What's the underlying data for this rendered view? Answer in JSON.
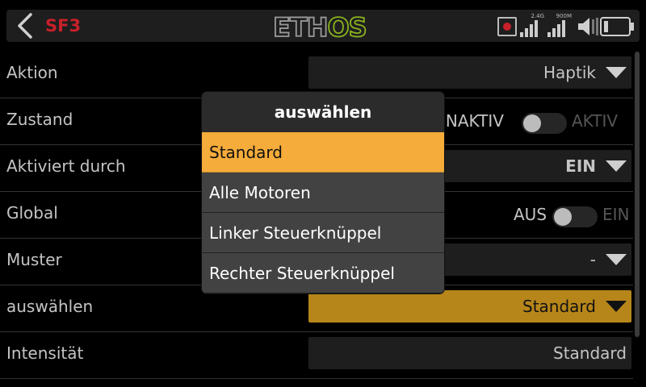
{
  "header": {
    "function_id": "SF3",
    "logo_text": "ETHOS",
    "signal_labels": [
      "2.4G",
      "900M"
    ],
    "icons": [
      "back-arrow-icon",
      "record-icon",
      "rssi-2-4g-icon",
      "rssi-900m-icon",
      "speaker-icon",
      "battery-icon"
    ],
    "colors": {
      "function_id": "#c8202a",
      "logo_accent": "#8bb31f"
    }
  },
  "rows": {
    "aktion": {
      "label": "Aktion",
      "value": "Haptik"
    },
    "zustand": {
      "label": "Zustand",
      "off": "INAKTIV",
      "on": "AKTIV"
    },
    "aktiviert": {
      "label": "Aktiviert durch",
      "value": "EIN"
    },
    "global": {
      "label": "Global",
      "off": "AUS",
      "on": "EIN"
    },
    "muster": {
      "label": "Muster",
      "value": "-"
    },
    "auswaehlen": {
      "label": "auswählen",
      "value": "Standard"
    },
    "intensitaet": {
      "label": "Intensität",
      "value": "Standard"
    }
  },
  "popup": {
    "title": "auswählen",
    "options": [
      "Standard",
      "Alle Motoren",
      "Linker Steuerknüppel",
      "Rechter Steuerknüppel"
    ],
    "selected": "Standard"
  }
}
